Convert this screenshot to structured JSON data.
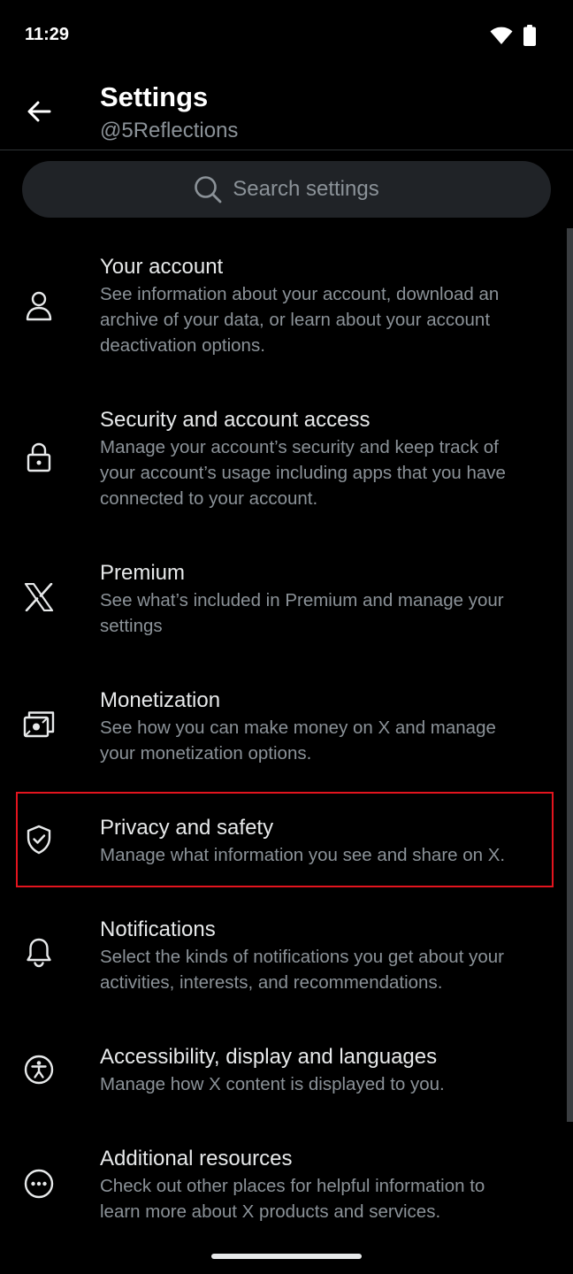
{
  "status_bar": {
    "time": "11:29",
    "icons": [
      "wifi-icon",
      "battery-icon"
    ]
  },
  "header": {
    "title": "Settings",
    "subtitle": "@5Reflections",
    "back_icon": "arrow-left-icon"
  },
  "search": {
    "placeholder": "Search settings",
    "icon": "search-icon"
  },
  "settings_items": [
    {
      "icon": "person-icon",
      "title": "Your account",
      "desc_lines": [
        "See information about your account, download an",
        "archive of your data, or learn about your account",
        "deactivation options."
      ]
    },
    {
      "icon": "lock-icon",
      "title": "Security and account access",
      "desc_lines": [
        "Manage your account’s security and keep track of",
        "your account’s usage including apps that you have",
        "connected to your account."
      ]
    },
    {
      "icon": "x-logo-icon",
      "title": "Premium",
      "desc_lines": [
        "See what’s included in Premium and manage your",
        "settings"
      ]
    },
    {
      "icon": "money-icon",
      "title": "Monetization",
      "desc_lines": [
        "See how you can make money on X and manage",
        "your monetization options."
      ]
    },
    {
      "icon": "shield-check-icon",
      "title": "Privacy and safety",
      "desc_lines": [
        "Manage what information you see and share on X."
      ],
      "highlighted": true
    },
    {
      "icon": "bell-icon",
      "title": "Notifications",
      "desc_lines": [
        "Select the kinds of notifications you get about your",
        "activities, interests, and recommendations."
      ]
    },
    {
      "icon": "accessibility-icon",
      "title": "Accessibility, display and languages",
      "desc_lines": [
        "Manage how X content is displayed to you."
      ]
    },
    {
      "icon": "more-circle-icon",
      "title": "Additional resources",
      "desc_lines": [
        "Check out other places for helpful information to",
        "learn more about X products and services."
      ]
    }
  ],
  "colors": {
    "background": "#000000",
    "primary_text": "#e7e9ea",
    "secondary_text": "#8b9298",
    "highlight": "#e3141e"
  }
}
